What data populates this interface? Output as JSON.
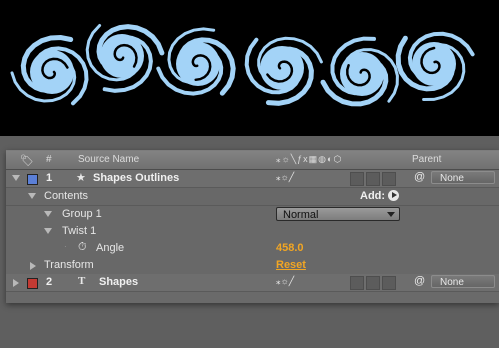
{
  "header": {
    "num": "#",
    "source_name": "Source Name",
    "parent": "Parent"
  },
  "colors": {
    "swirl": "#a3d3f7",
    "label_blue": "#5b7fd6",
    "label_red": "#c33a33",
    "value_orange": "#f2a623"
  },
  "layers": [
    {
      "number": "1",
      "name": "Shapes Outlines",
      "type_icon": "star-icon",
      "label_color": "#5b7fd6",
      "parent": "None"
    },
    {
      "number": "2",
      "name": "Shapes",
      "type_icon": "text-layer-icon",
      "label_color": "#c33a33",
      "parent": "None"
    }
  ],
  "properties": {
    "contents": "Contents",
    "add_label": "Add:",
    "group": "Group 1",
    "blend_mode": "Normal",
    "twist": "Twist 1",
    "angle_label": "Angle",
    "angle_value": "458.0",
    "transform": "Transform",
    "reset": "Reset"
  }
}
